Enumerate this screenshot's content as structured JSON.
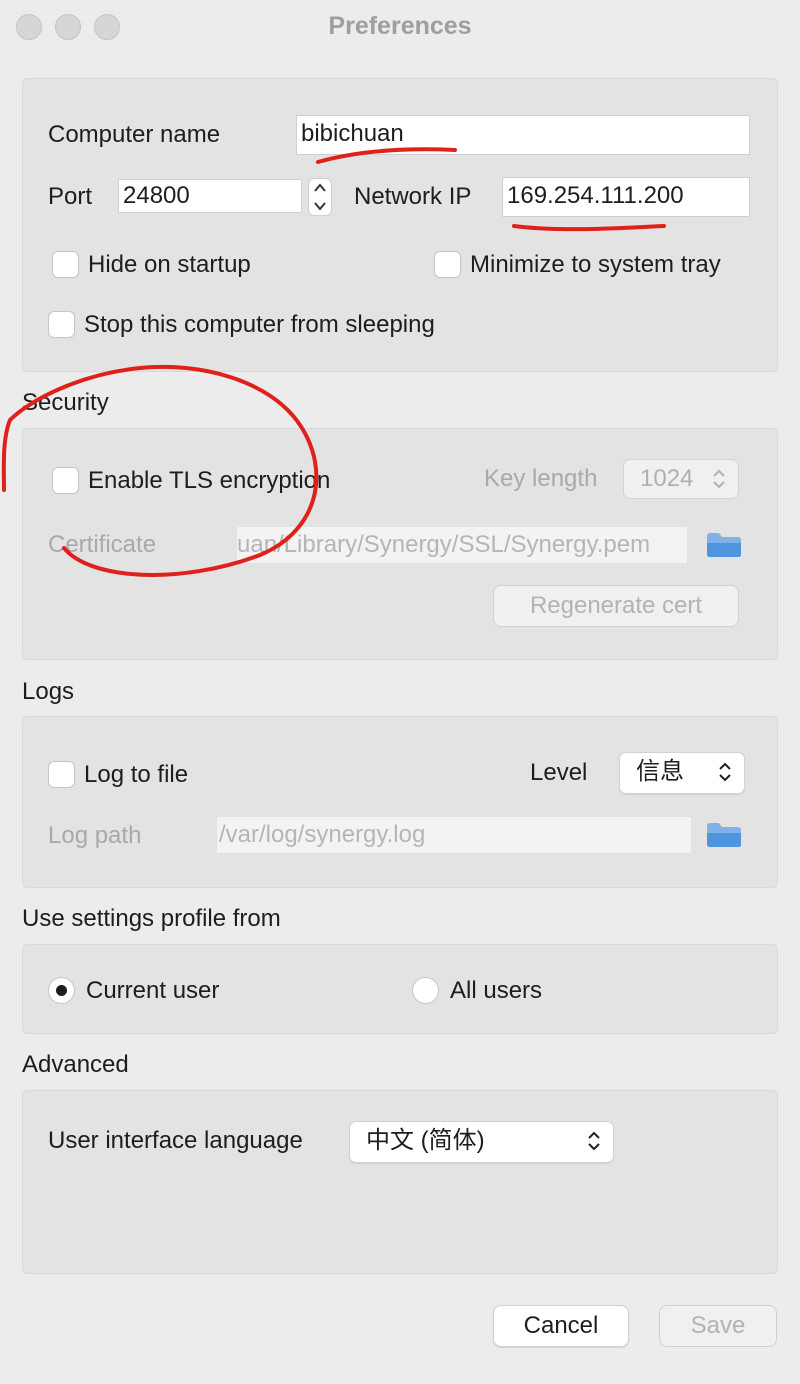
{
  "window": {
    "title": "Preferences"
  },
  "general": {
    "computer_name_label": "Computer name",
    "computer_name_value": "bibichuan",
    "port_label": "Port",
    "port_value": "24800",
    "network_ip_label": "Network IP",
    "network_ip_value": "169.254.111.200",
    "hide_on_startup": "Hide on startup",
    "minimize_to_tray": "Minimize to system tray",
    "stop_sleeping": "Stop this computer from sleeping"
  },
  "security": {
    "heading": "Security",
    "enable_tls": "Enable TLS encryption",
    "key_length_label": "Key length",
    "key_length_value": "1024",
    "certificate_label": "Certificate",
    "certificate_path": "uan/Library/Synergy/SSL/Synergy.pem",
    "regenerate_button": "Regenerate cert"
  },
  "logs": {
    "heading": "Logs",
    "log_to_file": "Log to file",
    "level_label": "Level",
    "level_value": "信息",
    "log_path_label": "Log path",
    "log_path_value": "/var/log/synergy.log"
  },
  "profile": {
    "heading": "Use settings profile from",
    "current_user": "Current user",
    "all_users": "All users",
    "selected": "current_user"
  },
  "advanced": {
    "heading": "Advanced",
    "language_label": "User interface language",
    "language_value": "中文 (简体)"
  },
  "footer": {
    "cancel": "Cancel",
    "save": "Save"
  },
  "annotations": {
    "color": "#e0201a"
  }
}
